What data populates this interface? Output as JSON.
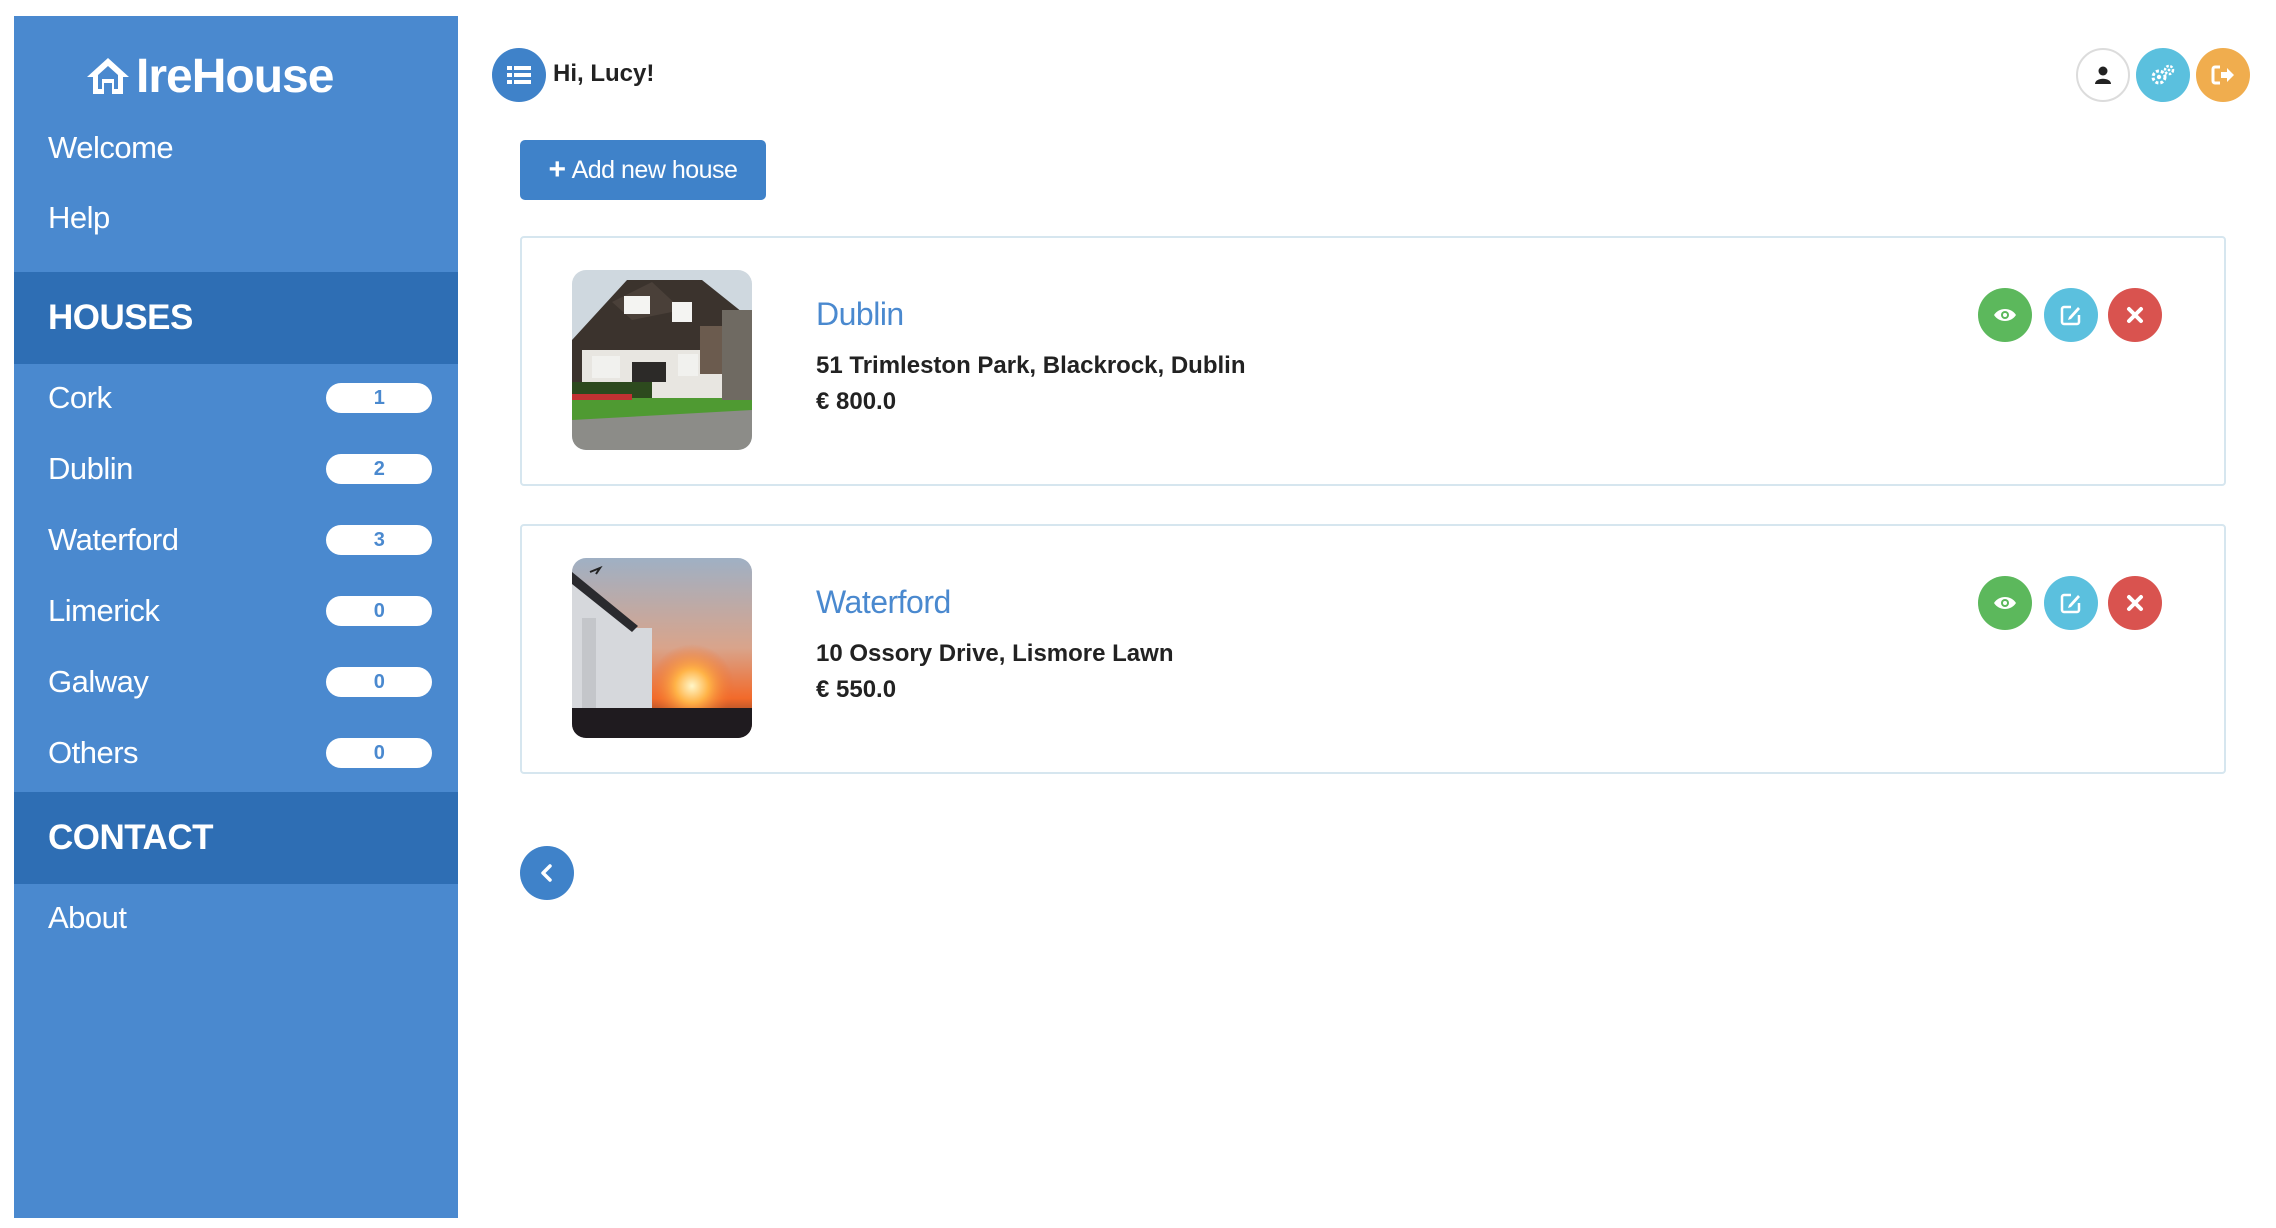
{
  "app": {
    "brand": "IreHouse"
  },
  "sidebar": {
    "links": [
      {
        "label": "Welcome"
      },
      {
        "label": "Help"
      }
    ],
    "houses_heading": "HOUSES",
    "houses": [
      {
        "label": "Cork",
        "count": "1"
      },
      {
        "label": "Dublin",
        "count": "2"
      },
      {
        "label": "Waterford",
        "count": "3"
      },
      {
        "label": "Limerick",
        "count": "0"
      },
      {
        "label": "Galway",
        "count": "0"
      },
      {
        "label": "Others",
        "count": "0"
      }
    ],
    "contact_heading": "CONTACT",
    "contact_links": [
      {
        "label": "About"
      }
    ]
  },
  "header": {
    "greeting": "Hi, Lucy!",
    "icons": [
      "list-icon",
      "user-icon",
      "settings-icon",
      "logout-icon"
    ]
  },
  "toolbar": {
    "add_label": "Add new house"
  },
  "listings": [
    {
      "title": "Dublin",
      "address": "51 Trimleston Park, Blackrock, Dublin",
      "price": "€ 800.0"
    },
    {
      "title": "Waterford",
      "address": "10 Ossory Drive, Lismore Lawn",
      "price": "€ 550.0"
    }
  ],
  "colors": {
    "sidebar": "#4a89cf",
    "sidebar_section": "#2e6eb4",
    "primary": "#3f82c9",
    "view": "#5cb85c",
    "edit": "#5bc0de",
    "delete": "#d9534f",
    "logout": "#f0ad4e"
  }
}
